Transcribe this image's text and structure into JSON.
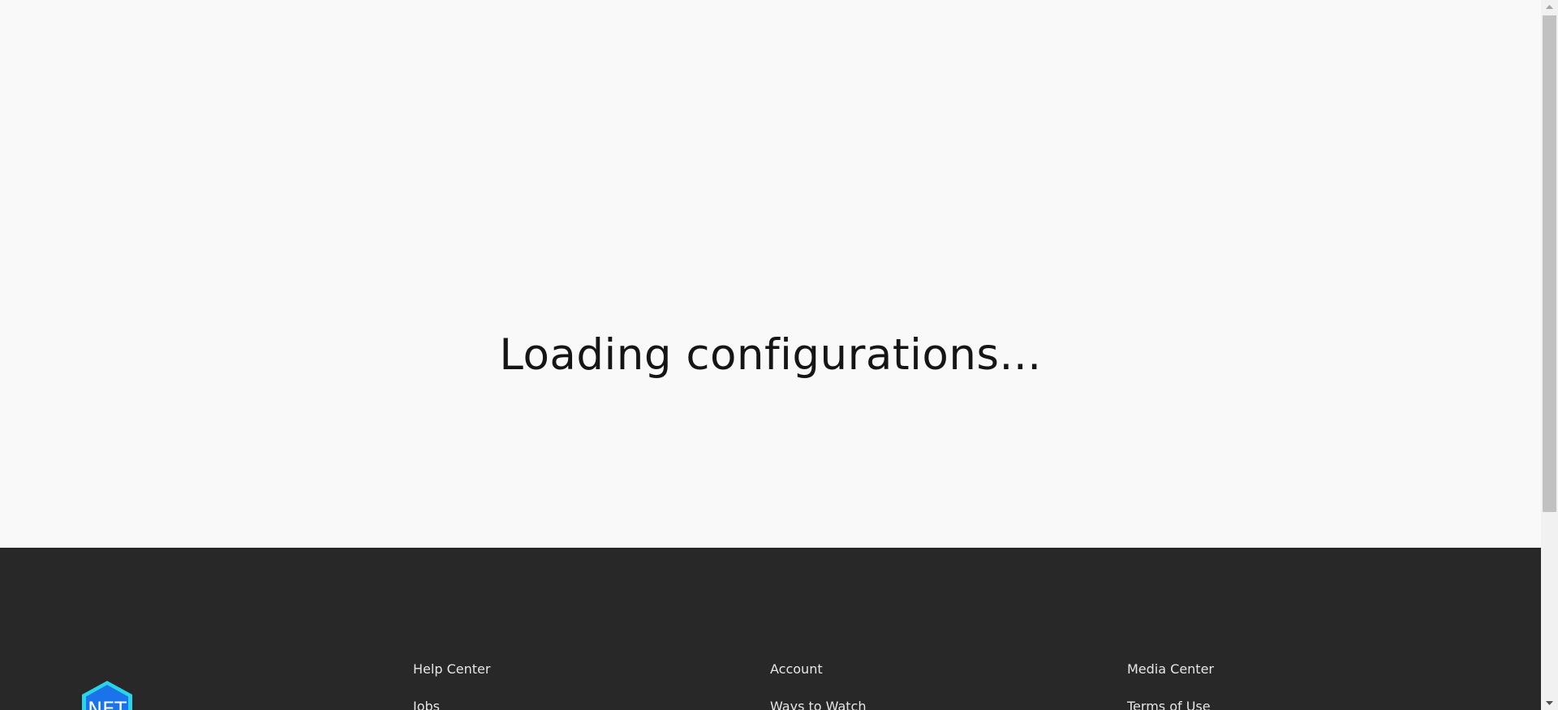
{
  "loading": {
    "message": "Loading configurations..."
  },
  "footer": {
    "logo": {
      "text": "NET",
      "icon": "hexagon-logo-icon",
      "colors": {
        "fill": "#1a73e8",
        "border": "#29d3e8"
      }
    },
    "columns": [
      {
        "links": [
          "Help Center",
          "Jobs"
        ]
      },
      {
        "links": [
          "Account",
          "Ways to Watch"
        ]
      },
      {
        "links": [
          "Media Center",
          "Terms of Use"
        ]
      }
    ],
    "background": "#282828"
  },
  "scrollbar": {
    "up_icon": "scroll-up-arrow-icon",
    "down_icon": "scroll-down-arrow-icon"
  }
}
